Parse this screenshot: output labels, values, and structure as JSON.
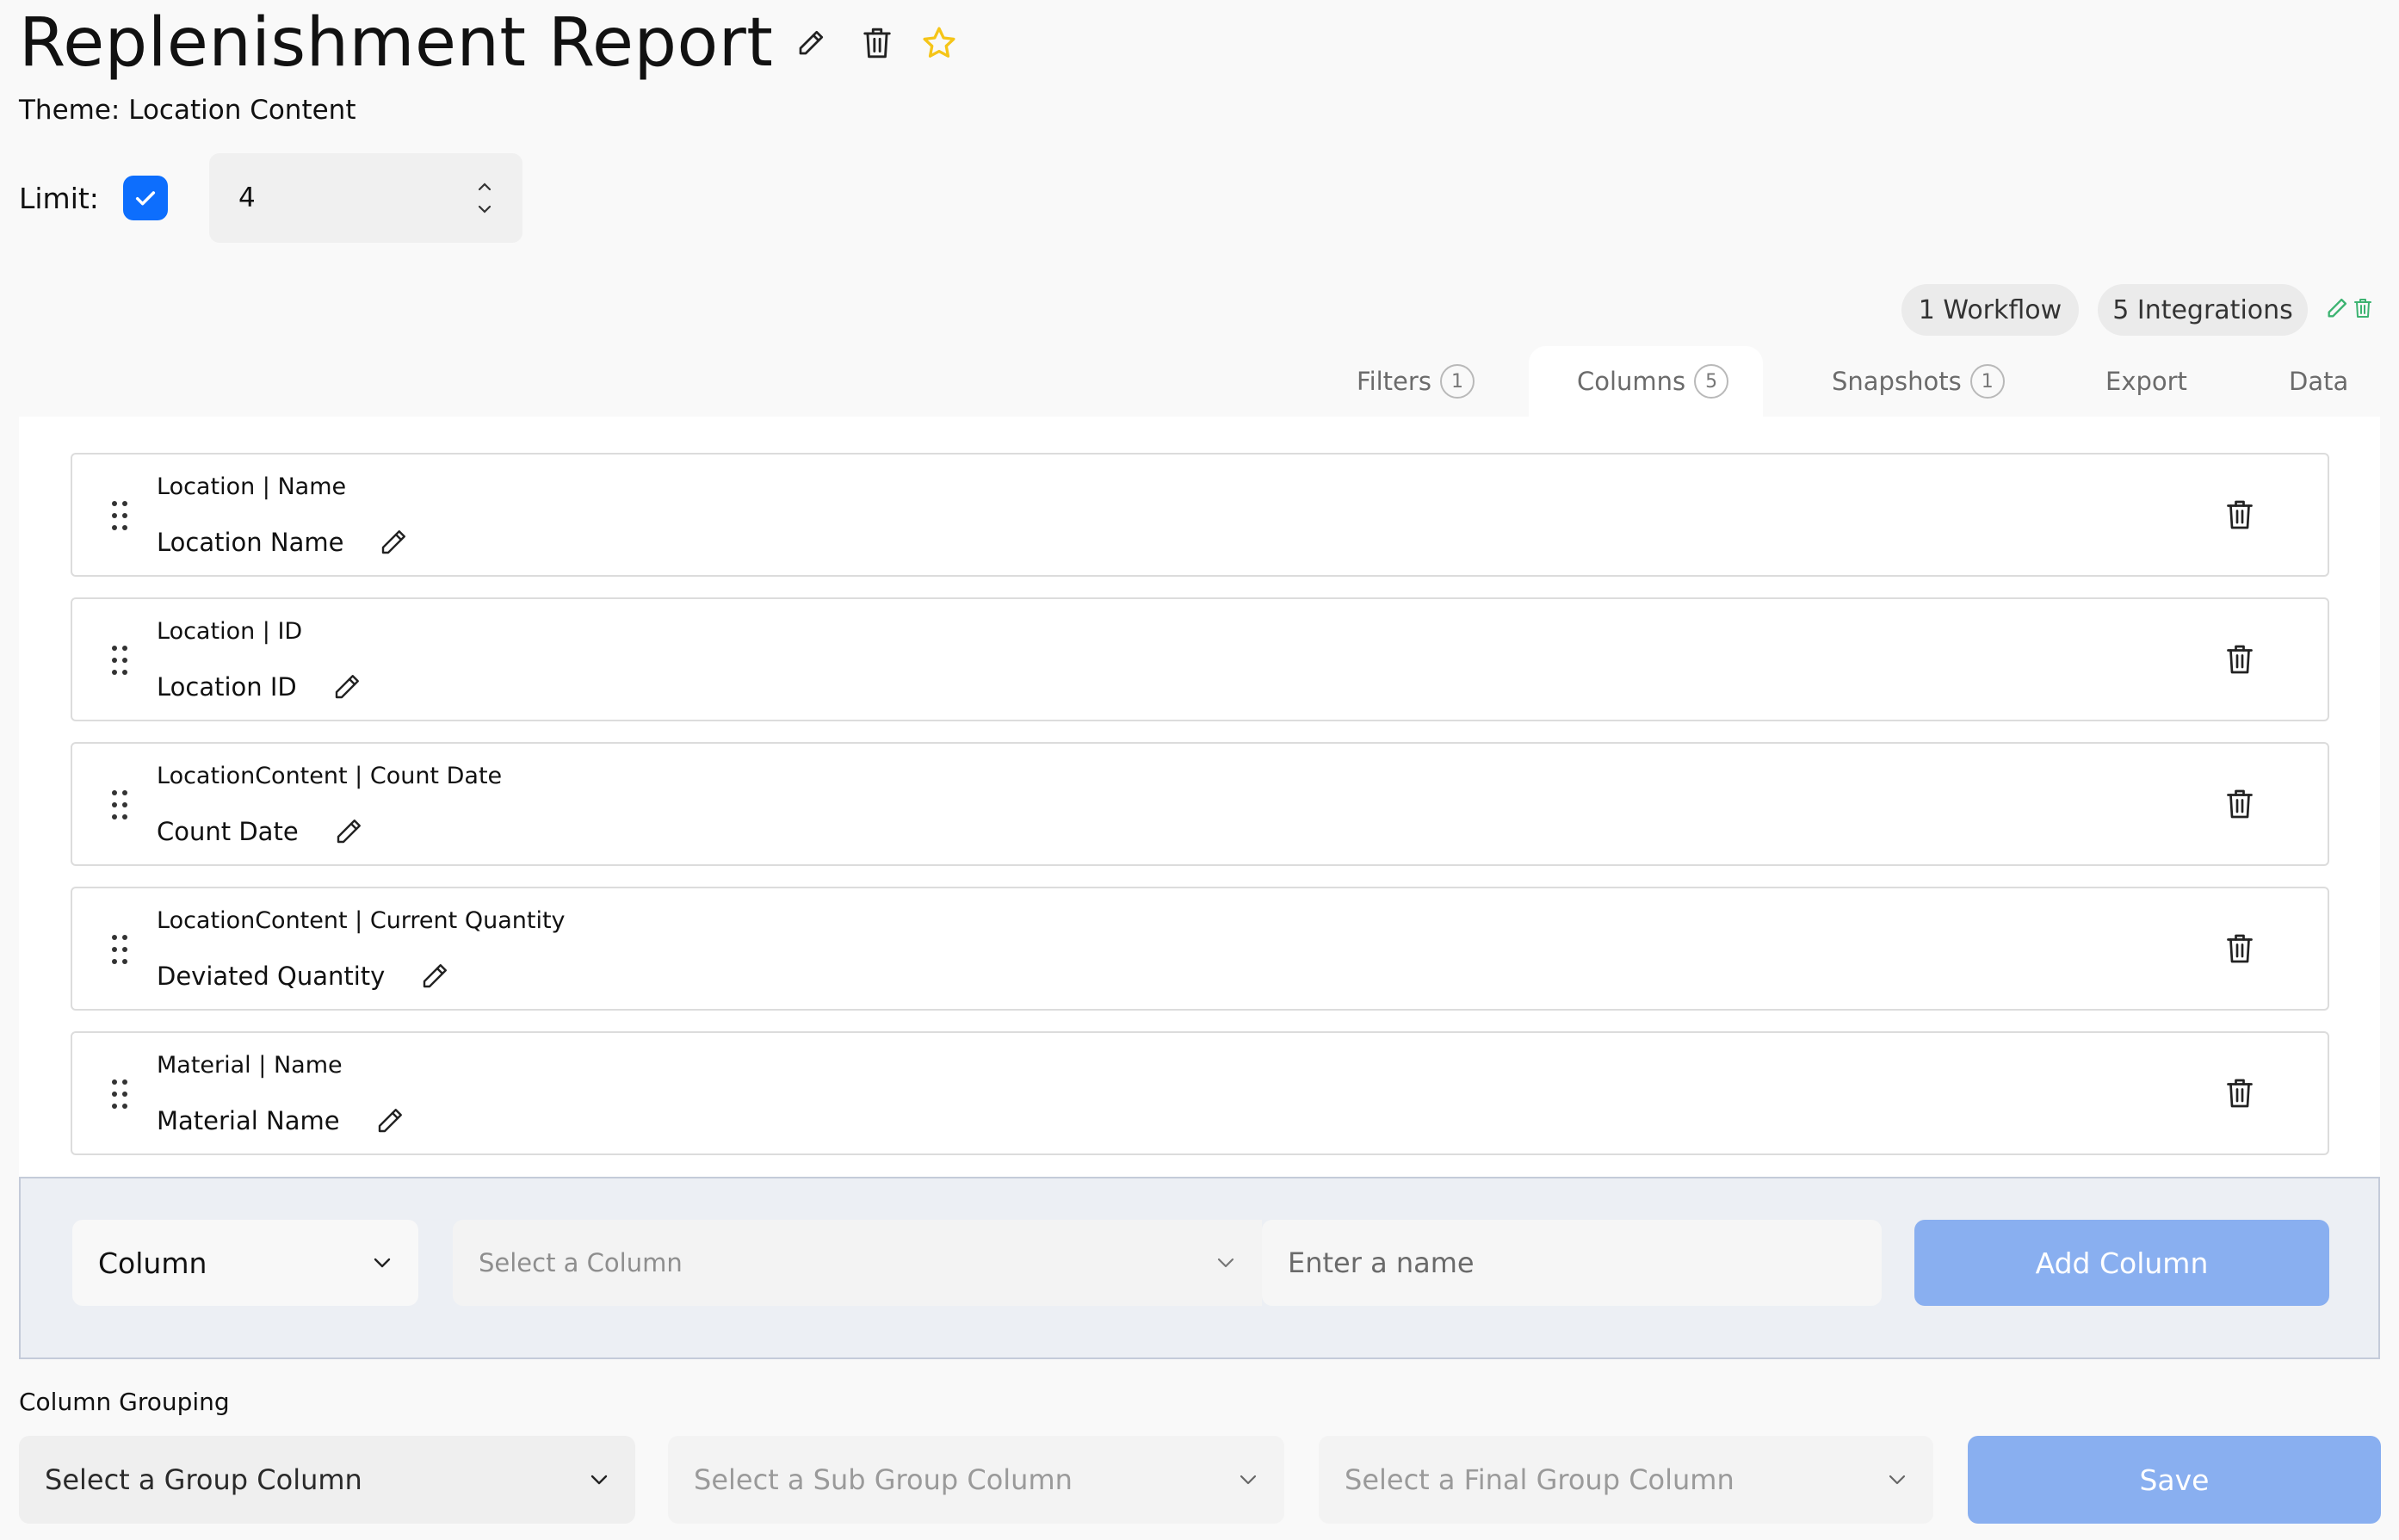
{
  "header": {
    "title": "Replenishment Report",
    "theme_text": "Theme: Location Content",
    "accent_star_color": "#f5c518"
  },
  "limit": {
    "label": "Limit:",
    "enabled": true,
    "value": "4"
  },
  "pills": {
    "workflow": "1 Workflow",
    "integrations": "5 Integrations",
    "action_color": "#3cb371"
  },
  "tabs": [
    {
      "label": "Filters",
      "badge": "1",
      "active": false
    },
    {
      "label": "Columns",
      "badge": "5",
      "active": true
    },
    {
      "label": "Snapshots",
      "badge": "1",
      "active": false
    },
    {
      "label": "Export",
      "badge": "",
      "active": false
    },
    {
      "label": "Data",
      "badge": "",
      "active": false
    }
  ],
  "columns": [
    {
      "source": "Location | Name",
      "name": "Location Name"
    },
    {
      "source": "Location | ID",
      "name": "Location ID"
    },
    {
      "source": "LocationContent | Count Date",
      "name": "Count Date"
    },
    {
      "source": "LocationContent | Current Quantity",
      "name": "Deviated Quantity"
    },
    {
      "source": "Material | Name",
      "name": "Material Name"
    }
  ],
  "add_column": {
    "type_value": "Column",
    "column_placeholder": "Select a Column",
    "name_placeholder": "Enter a name",
    "button_label": "Add Column"
  },
  "grouping": {
    "label": "Column Grouping",
    "group_placeholder": "Select a Group Column",
    "subgroup_placeholder": "Select a Sub Group Column",
    "final_placeholder": "Select a Final Group Column",
    "save_label": "Save"
  },
  "colors": {
    "primary": "#0d6efd",
    "button_disabled": "#89aff0"
  }
}
